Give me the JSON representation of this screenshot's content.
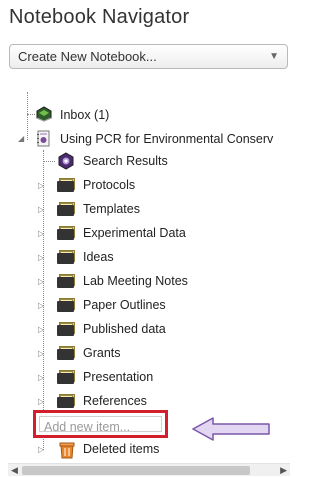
{
  "title": "Notebook Navigator",
  "dropdown": {
    "value": "Create New Notebook..."
  },
  "tree": {
    "inbox": {
      "label": "Inbox (1)",
      "icon": "inbox-tray-icon"
    },
    "notebook": {
      "label": "Using PCR for Environmental Conserv",
      "icon": "notebook-icon"
    },
    "items": [
      {
        "label": "Search Results",
        "icon": "search-results-icon"
      },
      {
        "label": "Protocols",
        "icon": "folder-icon"
      },
      {
        "label": "Templates",
        "icon": "folder-icon"
      },
      {
        "label": "Experimental Data",
        "icon": "folder-icon"
      },
      {
        "label": "Ideas",
        "icon": "folder-icon"
      },
      {
        "label": "Lab Meeting Notes",
        "icon": "folder-icon"
      },
      {
        "label": "Paper Outlines",
        "icon": "folder-icon"
      },
      {
        "label": "Published data",
        "icon": "folder-icon"
      },
      {
        "label": "Grants",
        "icon": "folder-icon"
      },
      {
        "label": "Presentation",
        "icon": "folder-icon"
      },
      {
        "label": "References",
        "icon": "folder-icon"
      }
    ],
    "add_item": {
      "placeholder": "Add new item..."
    },
    "deleted": {
      "label": "Deleted items",
      "icon": "trash-icon"
    }
  },
  "colors": {
    "highlight_border": "#d21f2c",
    "callout_arrow_fill": "#e3d6f2",
    "callout_arrow_stroke": "#7b57a8"
  }
}
